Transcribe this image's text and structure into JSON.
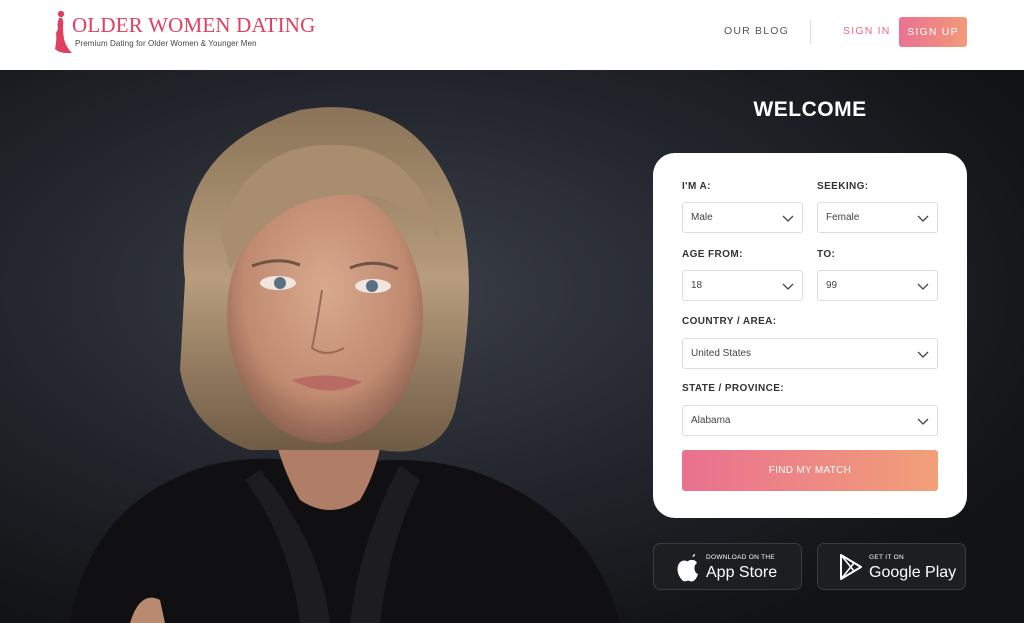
{
  "header": {
    "logo_title": "OLDER WOMEN DATING",
    "logo_subtitle": "Premium Dating for Older Women & Younger Men",
    "nav": {
      "blog": "OUR BLOG",
      "sign_in": "SIGN IN",
      "sign_up": "SIGN UP"
    }
  },
  "hero": {
    "welcome": "WELCOME"
  },
  "form": {
    "im_a": {
      "label": "I'M A:",
      "value": "Male"
    },
    "seeking": {
      "label": "SEEKING:",
      "value": "Female"
    },
    "age_from": {
      "label": "AGE FROM:",
      "value": "18"
    },
    "age_to": {
      "label": "TO:",
      "value": "99"
    },
    "country": {
      "label": "COUNTRY / AREA:",
      "value": "United States"
    },
    "state": {
      "label": "STATE / PROVINCE:",
      "value": "Alabama"
    },
    "submit": "FIND MY MATCH"
  },
  "badges": {
    "app_store": {
      "small": "DOWNLOAD ON THE",
      "big": "App Store"
    },
    "google_play": {
      "small": "GET IT ON",
      "big": "Google Play"
    }
  },
  "colors": {
    "brand_red": "#e0405f",
    "button_gradient_start": "#eb7191",
    "button_gradient_end": "#f29a7a",
    "hero_background": "#24272e"
  }
}
